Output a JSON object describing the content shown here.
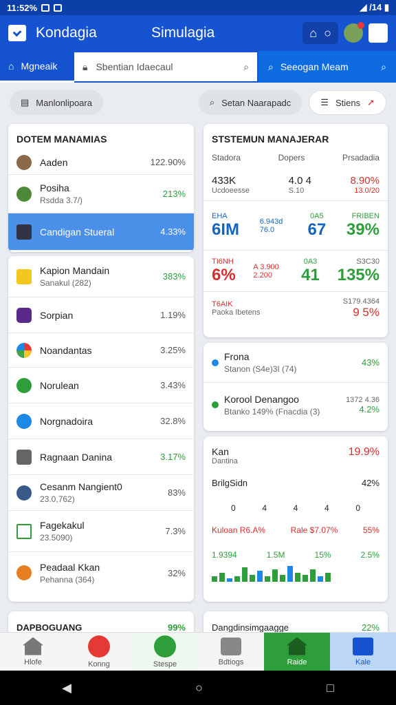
{
  "status": {
    "time": "11:52%",
    "right": "◢ /14 ▮"
  },
  "appbar": {
    "title": "Kondagia",
    "center": "Simulagia"
  },
  "searchrow": {
    "tab": "Mgneaik",
    "search1": "Sbentian Idaecaul",
    "search2": "Seeogan Meam"
  },
  "filters": {
    "chip1": "Manlonlipoara",
    "chip2": "Setan Naarapadc",
    "chip3": "Stiens"
  },
  "left_card1": {
    "title": "DOTEM MANAMIAS",
    "rows": [
      {
        "name": "Aaden",
        "sub": "",
        "value": "122.90%",
        "color": "#555"
      },
      {
        "name": "Posiha",
        "sub": "Rsdda 3.7/)",
        "value": "213%",
        "color": "green"
      },
      {
        "name": "Candigan Stueral",
        "sub": "",
        "value": "4.33%",
        "color": "#fff"
      }
    ]
  },
  "left_card2": {
    "rows": [
      {
        "name": "Kapion Mandain",
        "sub": "Sanakul (282)",
        "value": "383%",
        "color": "green"
      },
      {
        "name": "Sorpian",
        "sub": "",
        "value": "1.19%",
        "color": "#555"
      },
      {
        "name": "Noandantas",
        "sub": "",
        "value": "3.25%",
        "color": "#555"
      },
      {
        "name": "Norulean",
        "sub": "",
        "value": "3.43%",
        "color": "#555"
      },
      {
        "name": "Norgnadoira",
        "sub": "",
        "value": "32.8%",
        "color": "#555"
      },
      {
        "name": "Ragnaan Danina",
        "sub": "",
        "value": "3.17%",
        "color": "green"
      },
      {
        "name": "Cesanm Nangient0",
        "sub": "23.0,762)",
        "value": "83%",
        "color": "#555"
      },
      {
        "name": "Fagekakul",
        "sub": "23.5090)",
        "value": "7.3%",
        "color": "#555"
      },
      {
        "name": "Peadaal Kkan",
        "sub": "Pehanna (364)",
        "value": "32%",
        "color": "#555"
      }
    ]
  },
  "left_card3": {
    "title": "DAPBOGUANG",
    "value": "99%"
  },
  "right_card1": {
    "title": "STSTEMUN MANAJERAR",
    "headers": [
      "Stadora",
      "Dopers",
      "Prsadadia"
    ],
    "row1": {
      "a": "433K",
      "a_sub": "Ucdoeesse",
      "b": "4.0 4",
      "b_sub": "S.10",
      "c": "8.90%",
      "c_sub": "13.0/20"
    },
    "row2": {
      "label": "EHA",
      "big": "6IM",
      "mid": "6.943d 76.0 ",
      "mid_lbl": "0A5",
      "mid_big": "67",
      "right_lbl": "FRIBEN",
      "right_big": "39%"
    },
    "row3": {
      "label": "TI6NH",
      "big": "6%",
      "mid": "A 3.900 2.200",
      "mid_lbl": "0A3",
      "mid_big": "41",
      "right_lbl": "S3C30",
      "right_big": "135%"
    },
    "row4": {
      "label": "T6AIK",
      "sub": "Paoka Ibetens",
      "right_top": "S179.4364",
      "right_big": "9 5%"
    }
  },
  "right_card2": {
    "rows": [
      {
        "name": "Frona",
        "sub": "Stanon (S4e)3I (74)",
        "value": "43%"
      },
      {
        "name": "Korool Denangoo",
        "sub": "Btanko 149% (Fnacdia (3)",
        "value": "4.2%",
        "top": "1372 4.36"
      }
    ]
  },
  "right_card3": {
    "title": "Kan",
    "subtitle": "Dantina",
    "value": "19.9%",
    "mid": "BrilgSidn",
    "mid_val": "42%",
    "nums": [
      "0",
      "4",
      "4",
      "4",
      "0"
    ],
    "legend": [
      "Kuloan R6.A%",
      "Rale $7.07%",
      "55%"
    ],
    "bar_labels": [
      "1.9394",
      "1.5M",
      "15%",
      "2.5%"
    ],
    "bars": [
      0.3,
      0.5,
      0.2,
      0.3,
      0.8,
      0.4,
      0.6,
      0.3,
      0.7,
      0.4,
      0.9,
      0.5,
      0.4,
      0.7,
      0.3,
      0.5
    ]
  },
  "right_card4": {
    "title": "Dangdinsimgaagge",
    "value": "22%"
  },
  "bottomnav": {
    "items": [
      "Hlofe",
      "Konng",
      "Stespe",
      "Bdtiogs",
      "Raide",
      "Kale"
    ]
  },
  "navbar": {
    "back": "◀",
    "home": "○",
    "recent": "□"
  }
}
